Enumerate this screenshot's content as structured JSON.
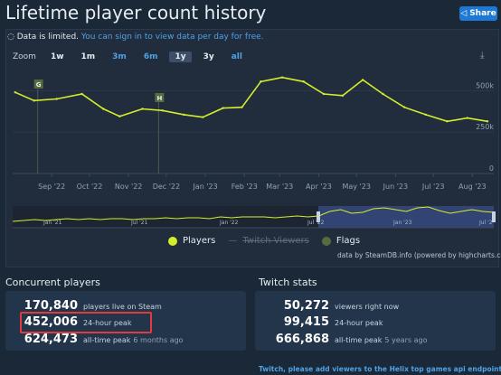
{
  "page": {
    "title": "Lifetime player count history",
    "share_label": "Share"
  },
  "notice": {
    "text": "Data is limited. ",
    "link": "You can sign in to view data per day for free."
  },
  "zoom": {
    "label": "Zoom",
    "options": [
      "1w",
      "1m",
      "3m",
      "6m",
      "1y",
      "3y",
      "all"
    ],
    "selected": "1y",
    "accent_options": [
      "3m",
      "6m",
      "all"
    ]
  },
  "chart_data": {
    "type": "line",
    "series": [
      {
        "name": "Players",
        "color": "#d5ee2c",
        "x": [
          "2022-08-03",
          "2022-08-18",
          "2022-09-05",
          "2022-09-25",
          "2022-10-12",
          "2022-10-25",
          "2022-11-12",
          "2022-11-28",
          "2022-12-15",
          "2022-12-30",
          "2023-01-15",
          "2023-01-30",
          "2023-02-14",
          "2023-03-03",
          "2023-03-20",
          "2023-04-05",
          "2023-04-20",
          "2023-05-06",
          "2023-05-22",
          "2023-06-08",
          "2023-06-25",
          "2023-07-12",
          "2023-07-28",
          "2023-08-13"
        ],
        "y": [
          490,
          440,
          450,
          480,
          390,
          345,
          390,
          380,
          355,
          340,
          395,
          400,
          555,
          580,
          555,
          480,
          470,
          565,
          480,
          400,
          355,
          315,
          335,
          315
        ]
      },
      {
        "name": "Twitch Viewers"
      },
      {
        "name": "Flags"
      }
    ],
    "flags": [
      {
        "label": "G",
        "x": "2022-08-18"
      },
      {
        "label": "H",
        "x": "2022-11-22"
      }
    ],
    "y_ticks": [
      "0",
      "250k",
      "500k"
    ],
    "ylim": [
      0,
      600000
    ],
    "x_ticks": [
      "Sep '22",
      "Oct '22",
      "Nov '22",
      "Dec '22",
      "Jan '23",
      "Feb '23",
      "Mar '23",
      "Apr '23",
      "May '23",
      "Jun '23",
      "Jul '23",
      "Aug '23"
    ],
    "navigator_labels": [
      "Jan '21",
      "Jul '21",
      "Jan '22",
      "Jul '22",
      "Jan '23",
      "Jul '2"
    ],
    "credit": "data by SteamDB.info (powered by highcharts.com)",
    "y_unit": "thousands"
  },
  "concurrent": {
    "title": "Concurrent players",
    "rows": [
      {
        "value": "170,840",
        "label": "players live on Steam",
        "sub": ""
      },
      {
        "value": "452,006",
        "label": "24-hour peak",
        "sub": ""
      },
      {
        "value": "624,473",
        "label": "all-time peak",
        "sub": "6 months ago"
      }
    ]
  },
  "twitch": {
    "title": "Twitch stats",
    "rows": [
      {
        "value": "50,272",
        "label": "viewers right now",
        "sub": ""
      },
      {
        "value": "99,415",
        "label": "24-hour peak",
        "sub": ""
      },
      {
        "value": "666,868",
        "label": "all-time peak",
        "sub": "5 years ago"
      }
    ],
    "footer": "Twitch, please add viewers to the Helix top games api endpoint."
  }
}
